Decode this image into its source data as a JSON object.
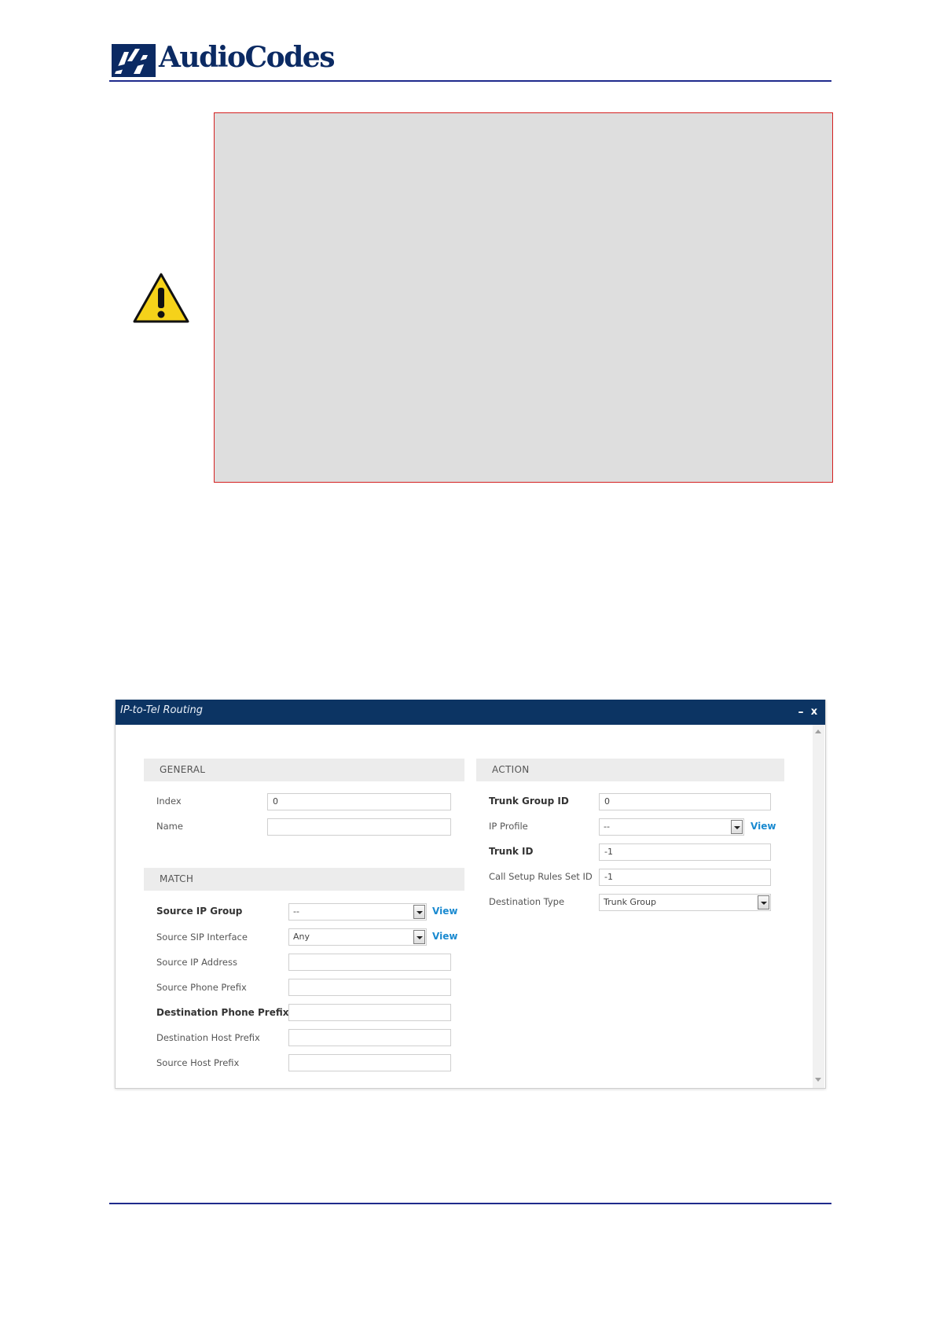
{
  "header": {
    "logo_text": "AudioCodes"
  },
  "colors": {
    "brand_navy": "#0b2a63",
    "rule_blue": "#1f2a8c",
    "note_border": "#d42020",
    "note_fill": "#dedede",
    "dialog_titlebar": "#0c3463",
    "link_blue": "#1a8ad0",
    "warning_yellow": "#f5d21a"
  },
  "note": {
    "icon": "warning-triangle-icon"
  },
  "dialog": {
    "title": "IP-to-Tel Routing",
    "minimize_label": "–",
    "close_label": "x",
    "general": {
      "header": "GENERAL",
      "index_label": "Index",
      "index_value": "0",
      "name_label": "Name",
      "name_value": ""
    },
    "match": {
      "header": "MATCH",
      "source_ip_group_label": "Source IP Group",
      "source_ip_group_value": "--",
      "source_sip_interface_label": "Source SIP Interface",
      "source_sip_interface_value": "Any",
      "source_ip_address_label": "Source IP Address",
      "source_ip_address_value": "",
      "source_phone_prefix_label": "Source Phone Prefix",
      "source_phone_prefix_value": "",
      "destination_phone_prefix_label": "Destination Phone Prefix",
      "destination_phone_prefix_value": "",
      "destination_host_prefix_label": "Destination Host Prefix",
      "destination_host_prefix_value": "",
      "source_host_prefix_label": "Source Host Prefix",
      "source_host_prefix_value": ""
    },
    "action": {
      "header": "ACTION",
      "trunk_group_id_label": "Trunk Group ID",
      "trunk_group_id_value": "0",
      "ip_profile_label": "IP Profile",
      "ip_profile_value": "--",
      "trunk_id_label": "Trunk ID",
      "trunk_id_value": "-1",
      "call_setup_rules_set_id_label": "Call Setup Rules Set ID",
      "call_setup_rules_set_id_value": "-1",
      "destination_type_label": "Destination Type",
      "destination_type_value": "Trunk Group"
    },
    "view_label": "View"
  }
}
